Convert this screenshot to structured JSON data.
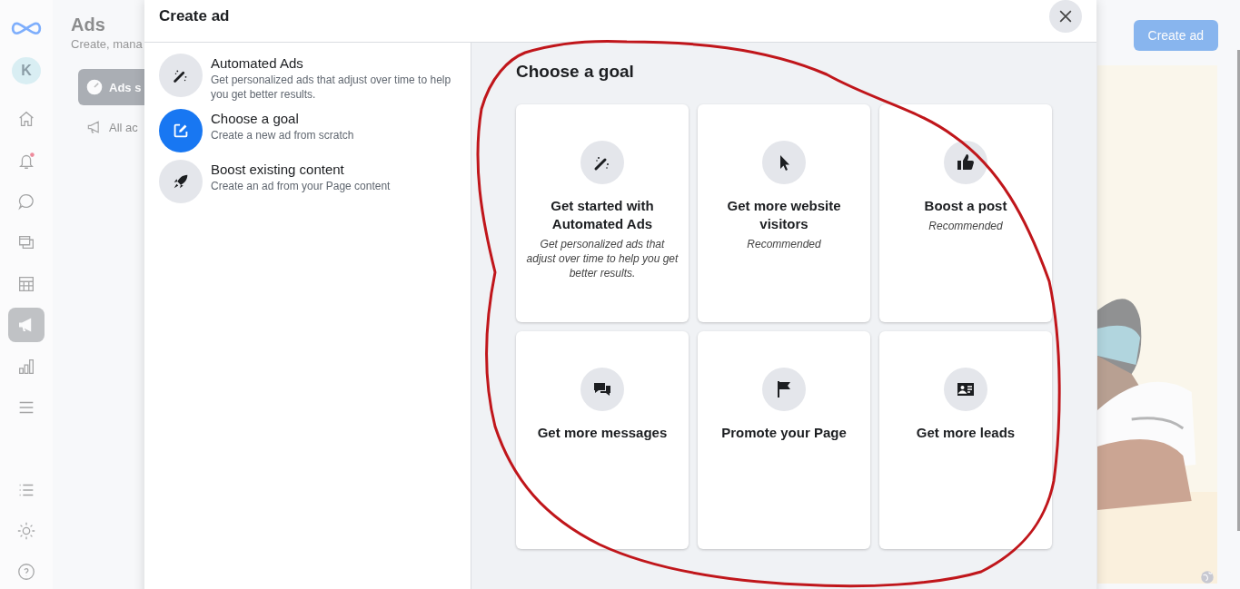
{
  "background": {
    "app_title": "Ads",
    "app_subtitle": "Create, mana",
    "avatar": "K",
    "create_button": "Create ad",
    "rail": [
      {
        "selected": false
      },
      {
        "selected": false
      },
      {
        "selected": false
      },
      {
        "selected": false
      },
      {
        "selected": false
      },
      {
        "selected": true
      },
      {
        "selected": false
      },
      {
        "selected": false
      },
      {
        "selected": false
      },
      {
        "selected": false
      },
      {
        "selected": false
      }
    ],
    "nav": [
      {
        "label": "Ads s",
        "selected": true
      },
      {
        "label": "All ac",
        "selected": false
      }
    ]
  },
  "dialog": {
    "title": "Create ad",
    "options": [
      {
        "title": "Automated Ads",
        "description": "Get personalized ads that adjust over time to help you get better results.",
        "selected": false
      },
      {
        "title": "Choose a goal",
        "description": "Create a new ad from scratch",
        "selected": true
      },
      {
        "title": "Boost existing content",
        "description": "Create an ad from your Page content",
        "selected": false
      }
    ],
    "goal_heading": "Choose a goal",
    "goals": [
      {
        "title": "Get started with Automated Ads",
        "subtitle": "Get personalized ads that adjust over time to help you get better results."
      },
      {
        "title": "Get more website visitors",
        "subtitle": "Recommended"
      },
      {
        "title": "Boost a post",
        "subtitle": "Recommended"
      },
      {
        "title": "Get more messages"
      },
      {
        "title": "Promote your Page"
      },
      {
        "title": "Get more leads"
      }
    ]
  }
}
